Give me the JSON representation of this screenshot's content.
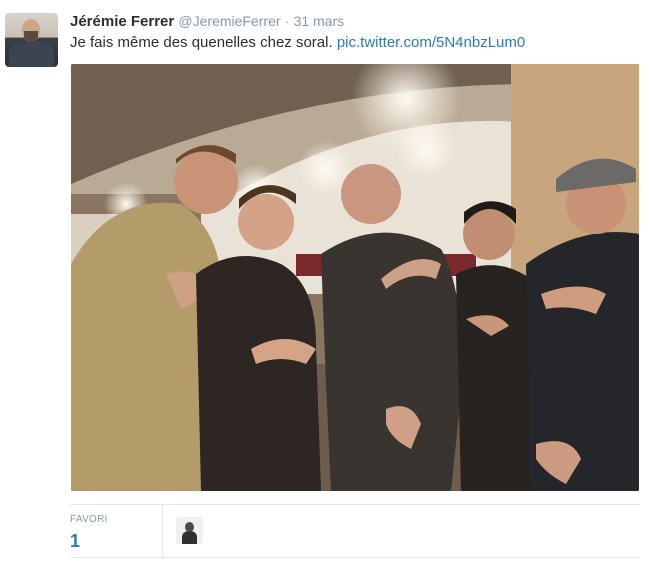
{
  "tweet": {
    "author_name": "Jérémie Ferrer",
    "author_handle": "@JeremieFerrer",
    "separator": "·",
    "date": "31 mars",
    "text": "Je fais même des quenelles chez soral.",
    "link": "pic.twitter.com/5N4nbzLum0"
  },
  "stats": {
    "favorites_label": "FAVORI",
    "favorites_count": "1"
  },
  "colors": {
    "link": "#2b7bb9",
    "muted": "#8899a6",
    "text": "#292f33",
    "border": "#e1e8ed"
  }
}
